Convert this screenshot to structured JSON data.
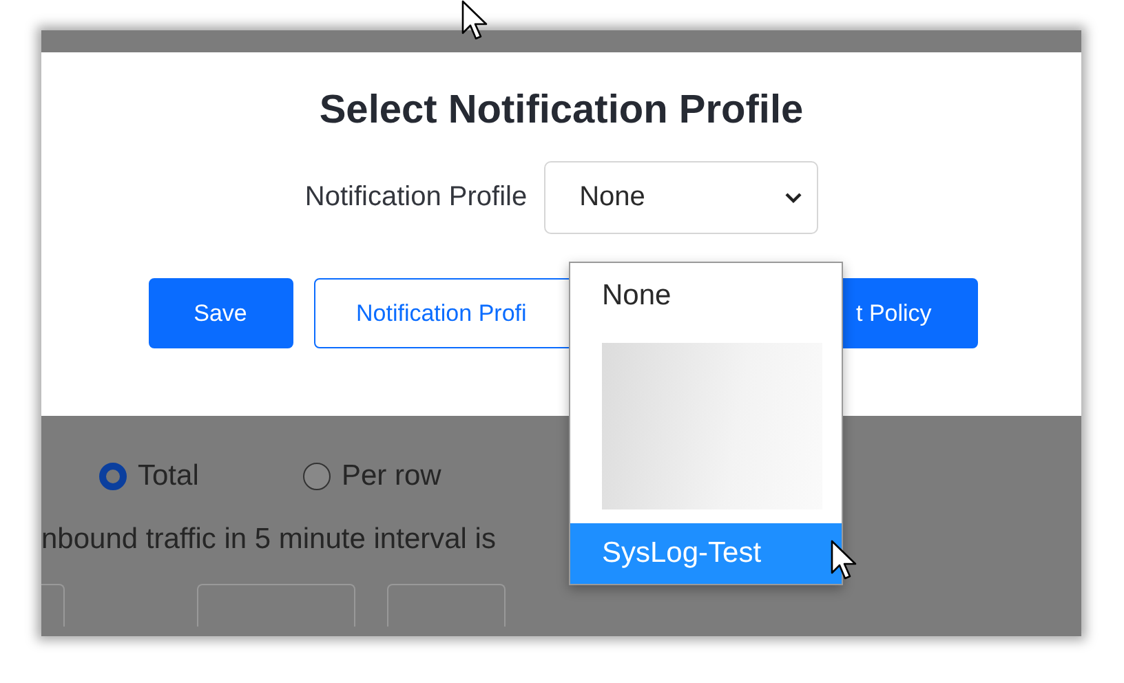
{
  "modal": {
    "title": "Select Notification Profile",
    "field_label": "Notification Profile",
    "select_value": "None",
    "buttons": [
      {
        "label": "Save",
        "kind": "primary"
      },
      {
        "label": "Notification Profi",
        "kind": "outline"
      },
      {
        "label": "t Policy",
        "kind": "primary"
      }
    ]
  },
  "dropdown": {
    "options": [
      {
        "label": "None",
        "kind": "option",
        "selected": false
      },
      {
        "kind": "redacted"
      },
      {
        "label": "SysLog-Test",
        "kind": "option",
        "selected": true
      }
    ]
  },
  "background": {
    "radios": [
      {
        "label": "Total",
        "selected": true
      },
      {
        "label": "Per row",
        "selected": false
      }
    ],
    "text": "nbound traffic in 5 minute interval is"
  }
}
